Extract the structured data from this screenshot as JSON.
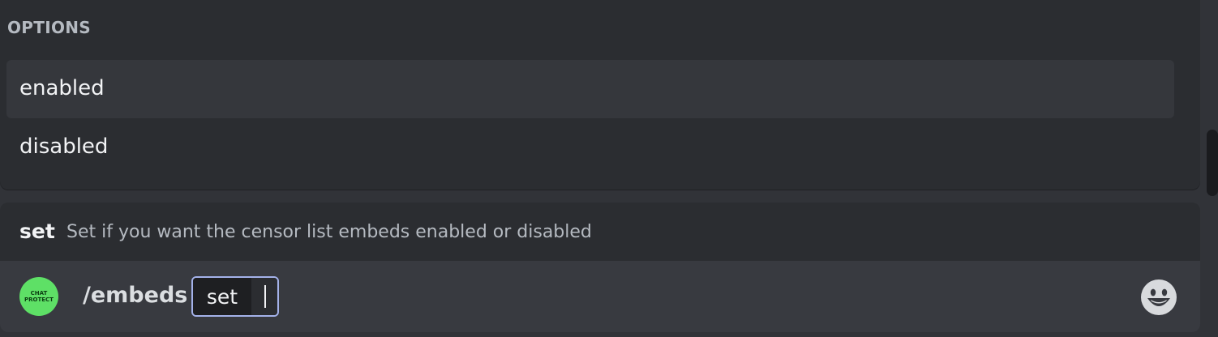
{
  "options_panel": {
    "header": "OPTIONS",
    "items": [
      {
        "label": "enabled",
        "selected": true
      },
      {
        "label": "disabled",
        "selected": false
      }
    ]
  },
  "command_hint": {
    "name": "set",
    "description": "Set if you want the censor list embeds enabled or disabled"
  },
  "input": {
    "avatar": {
      "line1": "CHAT",
      "line2": "PROTECT",
      "color": "#5ee066"
    },
    "command": "/embeds",
    "option_name": "set",
    "option_value": ""
  },
  "icons": {
    "emoji_button": "smiley-face-icon",
    "avatar": "chat-protect-bot-avatar"
  },
  "colors": {
    "background": "#313338",
    "panel": "#2b2d31",
    "selected_row": "#35373c",
    "input_bar": "#383a40",
    "pill_border": "#a4b2ea"
  }
}
